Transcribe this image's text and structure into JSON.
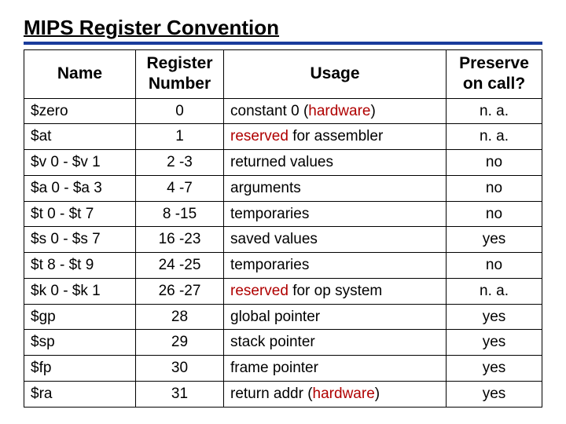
{
  "title": "MIPS Register Convention",
  "headers": {
    "name": "Name",
    "number": "Register Number",
    "usage": "Usage",
    "preserve": "Preserve on call?"
  },
  "rows": [
    {
      "name": "$zero",
      "number": "0",
      "usage_pre": "constant 0 (",
      "usage_hw": "hardware",
      "usage_post": ")",
      "preserve": "n. a."
    },
    {
      "name": "$at",
      "number": "1",
      "usage_res": "reserved",
      "usage_rest": " for assembler",
      "preserve": "n. a."
    },
    {
      "name": "$v 0 - $v 1",
      "number": "2 -3",
      "usage_plain": "returned values",
      "preserve": "no"
    },
    {
      "name": "$a 0 - $a 3",
      "number": "4 -7",
      "usage_plain": "arguments",
      "preserve": "no"
    },
    {
      "name": "$t 0 - $t 7",
      "number": "8 -15",
      "usage_plain": "temporaries",
      "preserve": "no"
    },
    {
      "name": "$s 0 - $s 7",
      "number": "16 -23",
      "usage_plain": "saved values",
      "preserve": "yes"
    },
    {
      "name": "$t 8 - $t 9",
      "number": "24 -25",
      "usage_plain": "temporaries",
      "preserve": "no"
    },
    {
      "name": "$k 0 - $k 1",
      "number": "26 -27",
      "usage_res": "reserved",
      "usage_rest": " for op system",
      "preserve": "n. a."
    },
    {
      "name": "$gp",
      "number": "28",
      "usage_plain": "global pointer",
      "preserve": "yes"
    },
    {
      "name": "$sp",
      "number": "29",
      "usage_plain": "stack pointer",
      "preserve": "yes"
    },
    {
      "name": "$fp",
      "number": "30",
      "usage_plain": "frame pointer",
      "preserve": "yes"
    },
    {
      "name": "$ra",
      "number": "31",
      "usage_pre": "return addr (",
      "usage_hw": "hardware",
      "usage_post": ")",
      "preserve": "yes"
    }
  ]
}
